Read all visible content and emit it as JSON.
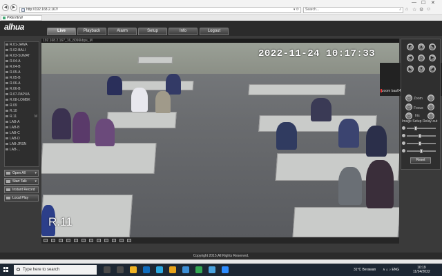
{
  "browser": {
    "address": "http://192.168.2.167/",
    "search_placeholder": "Search...",
    "tab_title": "PREVIEW",
    "address_tools": "▾ ⟳",
    "nav_icons": {
      "back": "◀",
      "forward": "▶",
      "search": "⌕",
      "home": "⌂",
      "star": "☆",
      "gear": "⚙",
      "smiley": "☺",
      "minimize": "—",
      "maximize": "☐",
      "close": "✕"
    }
  },
  "app": {
    "logo": "alhua",
    "tabs": [
      "Live",
      "Playback",
      "Alarm",
      "Setup",
      "Info",
      "Logout"
    ],
    "active_tab": "Live",
    "footer": "Copyright 2015,All Rights Reserved."
  },
  "sidebar": {
    "channels": [
      "R.01-JAWA",
      "R.02-BALI",
      "R.03-SUMAT",
      "R.04-A",
      "R.04-B",
      "R.05-A",
      "R.05-B",
      "R.06-A",
      "R.06-B",
      "R.07-PAPUA",
      "R.08-LOMBK",
      "R.09",
      "R.10",
      "R.11",
      "LAB-A",
      "LAB-B",
      "LAB-C",
      "LAB-D",
      "LAB-JRSN",
      "LAB-..."
    ],
    "recording_marker": "M",
    "buttons": [
      "Open All",
      "Start Talk",
      "Instant Record",
      "Local Play"
    ],
    "dropdown_glyph": "▾"
  },
  "video": {
    "header": "192.168.2.167_16_8096kbps_M",
    "timestamp": "2022-11-24 10:17:33",
    "channel_label": "R.11"
  },
  "zoom": {
    "initial": "Z",
    "name": "zoom baa04"
  },
  "ptz": {
    "arrows": [
      "◤",
      "▲",
      "◥",
      "◀",
      "⊙",
      "▶",
      "◣",
      "▼",
      "◢"
    ],
    "zoom_label": "Zoom",
    "focus_label": "Focus",
    "iris_label": "Iris",
    "minus": "−",
    "plus": "+",
    "image_setup": "Image Setup",
    "relay_out": "Relay-out",
    "reset": "Reset",
    "slider_levels": [
      0.3,
      0.45,
      0.45,
      0.5
    ]
  },
  "taskbar": {
    "search_placeholder": "Type here to search",
    "weather": "31°C Berawan",
    "tray_icons": "∧ ⌂ ♪ ENG",
    "time": "10:19",
    "date": "11/24/2022",
    "app_colors": [
      "#4a4a4a",
      "#4a4a4a",
      "#f0b323",
      "#0f6cbd",
      "#2ca8e0",
      "#e8a319",
      "#3d8fd6",
      "#34a853",
      "#4aa3df",
      "#2d8cff"
    ]
  }
}
